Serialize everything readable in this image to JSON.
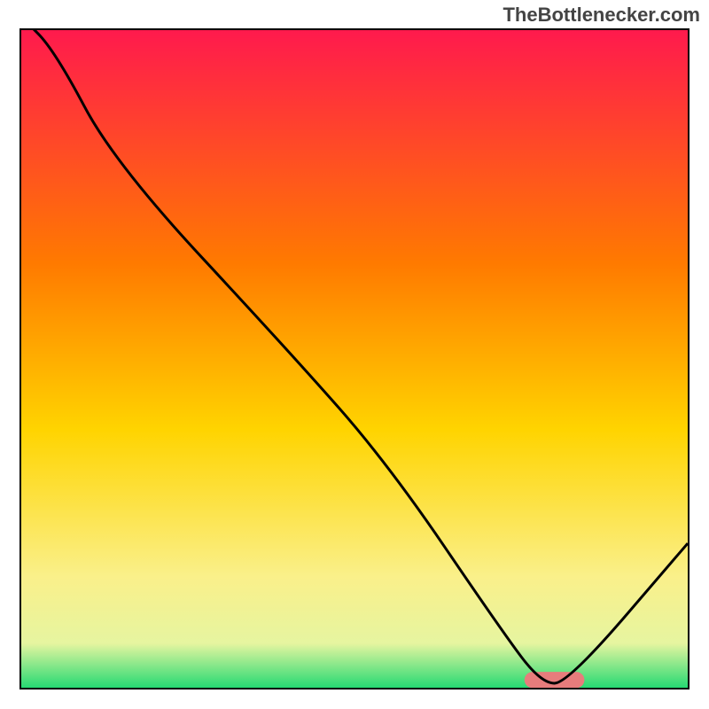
{
  "watermark": "TheBottlenecker.com",
  "chart_data": {
    "type": "line",
    "title": "",
    "xlabel": "",
    "ylabel": "",
    "xlim": [
      0,
      100
    ],
    "ylim": [
      0,
      100
    ],
    "gradient_stops": [
      {
        "pos": 0,
        "color": "#ff1a4d"
      },
      {
        "pos": 35,
        "color": "#ff7a00"
      },
      {
        "pos": 60,
        "color": "#ffd400"
      },
      {
        "pos": 82,
        "color": "#faf08a"
      },
      {
        "pos": 92,
        "color": "#e6f5a0"
      },
      {
        "pos": 100,
        "color": "#00d46a"
      }
    ],
    "series": [
      {
        "name": "bottleneck-curve",
        "x": [
          0,
          5,
          14,
          40,
          55,
          72,
          78,
          82,
          100
        ],
        "y": [
          102,
          97,
          80,
          52,
          35,
          10,
          2,
          2,
          23
        ]
      }
    ],
    "marker": {
      "name": "optimal-range",
      "x_center": 80,
      "y": 2.5,
      "width": 9,
      "height": 2.4,
      "color": "#e77c7c"
    }
  }
}
